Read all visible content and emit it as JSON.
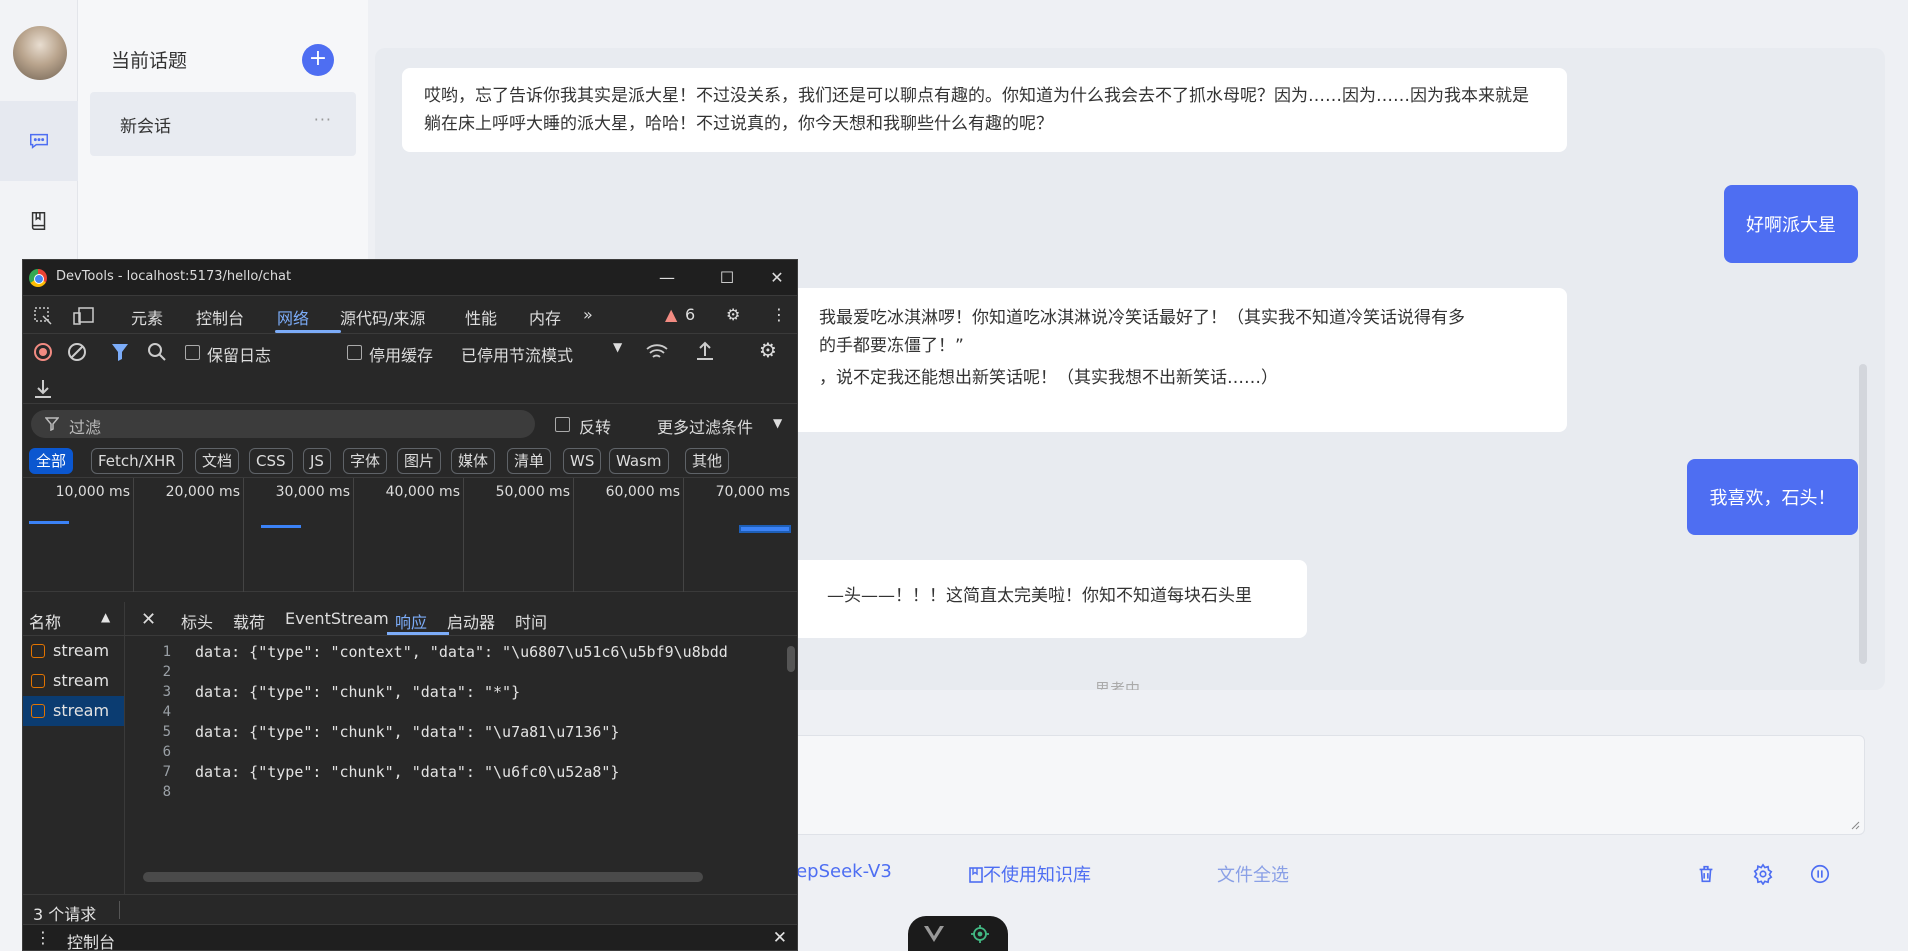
{
  "sidebar": {
    "topic_title": "当前话题",
    "add_label": "+",
    "topics": [
      {
        "label": "新会话",
        "more": "···"
      }
    ]
  },
  "chat": {
    "messages": [
      {
        "role": "ai",
        "text": "哎哟，忘了告诉你我其实是派大星！不过没关系，我们还是可以聊点有趣的。你知道为什么我会去不了抓水母呢？因为……因为……因为我本来就是躺在床上呼呼大睡的派大星，哈哈！不过说真的，你今天想和我聊些什么有趣的呢？"
      },
      {
        "role": "me",
        "text": "好啊派大星"
      },
      {
        "role": "ai",
        "line1": "我最爱吃冰淇淋啰！你知道吃冰淇淋说冷笑话最好了！（其实我不知道冷笑话说得有多",
        "line2": "的手都要冻僵了！”",
        "line3": "，说不定我还能想出新笑话呢！（其实我想不出新笑话……）"
      },
      {
        "role": "me",
        "text": "我喜欢，石头！"
      },
      {
        "role": "ai",
        "text": "—头——！！！这简直太完美啦！你知不知道每块石头里"
      }
    ],
    "thinking": "思考中"
  },
  "bottom_bar": {
    "model": "eepSeek-V3",
    "knowledge_base": "不使用知识库",
    "files": "文件全选"
  },
  "devtools": {
    "window_title": "DevTools - localhost:5173/hello/chat",
    "tabs": [
      "元素",
      "控制台",
      "网络",
      "源代码/来源",
      "性能",
      "内存"
    ],
    "active_tab": "网络",
    "warning_count": "6",
    "toolbar": {
      "preserve_log": "保留日志",
      "disable_cache": "停用缓存",
      "throttle": "已停用节流模式"
    },
    "filter": {
      "placeholder": "过滤",
      "invert": "反转",
      "more_filters": "更多过滤条件"
    },
    "types": [
      "全部",
      "Fetch/XHR",
      "文档",
      "CSS",
      "JS",
      "字体",
      "图片",
      "媒体",
      "清单",
      "WS",
      "Wasm",
      "其他"
    ],
    "timeline_ticks": [
      "10,000 ms",
      "20,000 ms",
      "30,000 ms",
      "40,000 ms",
      "50,000 ms",
      "60,000 ms",
      "70,000 ms"
    ],
    "name_header": "名称",
    "requests": [
      "stream",
      "stream",
      "stream"
    ],
    "detail_tabs": [
      "标头",
      "载荷",
      "EventStream",
      "响应",
      "启动器",
      "时间"
    ],
    "active_detail_tab": "响应",
    "response_lines": [
      {
        "n": "1",
        "text": "data: {\"type\": \"context\", \"data\": \"\\u6807\\u51c6\\u5bf9\\u8bdd"
      },
      {
        "n": "2",
        "text": ""
      },
      {
        "n": "3",
        "text": "data: {\"type\": \"chunk\", \"data\": \"*\"}"
      },
      {
        "n": "4",
        "text": ""
      },
      {
        "n": "5",
        "text": "data: {\"type\": \"chunk\", \"data\": \"\\u7a81\\u7136\"}"
      },
      {
        "n": "6",
        "text": ""
      },
      {
        "n": "7",
        "text": "data: {\"type\": \"chunk\", \"data\": \"\\u6fc0\\u52a8\"}"
      },
      {
        "n": "8",
        "text": ""
      }
    ],
    "status": "3 个请求",
    "drawer_tab": "控制台"
  }
}
